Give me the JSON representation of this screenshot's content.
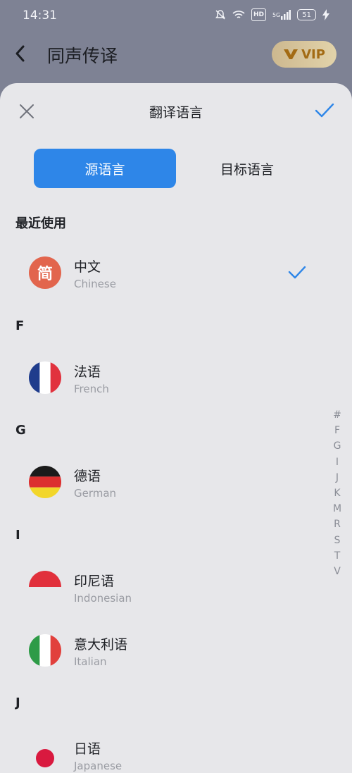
{
  "status_bar": {
    "time": "14:31",
    "network": "5G",
    "hd": "HD",
    "battery": "51"
  },
  "header": {
    "title": "同声传译",
    "vip_label": "VIP"
  },
  "sheet": {
    "title": "翻译语言",
    "tabs": {
      "source": "源语言",
      "target": "目标语言"
    },
    "sections": [
      {
        "title": "最近使用",
        "items": [
          {
            "name": "中文",
            "sub": "Chinese",
            "badge": "简",
            "selected": true
          }
        ]
      },
      {
        "title": "F",
        "items": [
          {
            "name": "法语",
            "sub": "French"
          }
        ]
      },
      {
        "title": "G",
        "items": [
          {
            "name": "德语",
            "sub": "German"
          }
        ]
      },
      {
        "title": "I",
        "items": [
          {
            "name": "印尼语",
            "sub": "Indonesian"
          },
          {
            "name": "意大利语",
            "sub": "Italian"
          }
        ]
      },
      {
        "title": "J",
        "items": [
          {
            "name": "日语",
            "sub": "Japanese"
          }
        ]
      }
    ],
    "index": [
      "#",
      "F",
      "G",
      "I",
      "J",
      "K",
      "M",
      "R",
      "S",
      "T",
      "V"
    ]
  },
  "colors": {
    "accent": "#2e86e8",
    "sheet_bg": "#e7e7ea",
    "chinese_badge": "#e2654d"
  }
}
